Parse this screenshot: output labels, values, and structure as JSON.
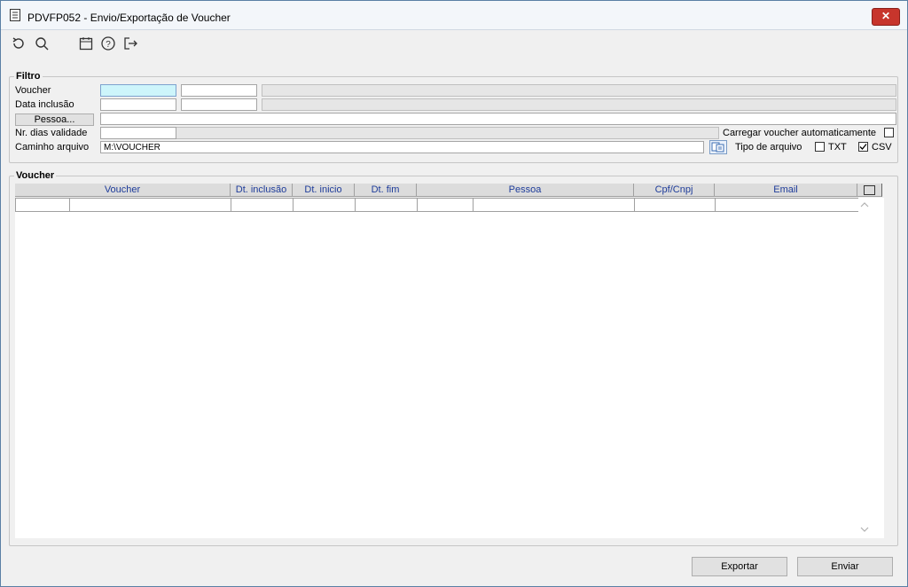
{
  "window": {
    "title": "PDVFP052 - Envio/Exportação de Voucher",
    "close_label": "✕"
  },
  "toolbar": {
    "icons": [
      "refresh-icon",
      "search-icon",
      "calendar-icon",
      "help-icon",
      "exit-icon"
    ]
  },
  "filtro": {
    "group_label": "Filtro",
    "voucher_label": "Voucher",
    "voucher_from": "",
    "voucher_to": "",
    "data_inclusao_label": "Data inclusão",
    "data_inclusao_from": "",
    "data_inclusao_to": "",
    "pessoa_button": "Pessoa...",
    "pessoa_value": "",
    "nr_dias_label": "Nr. dias validade",
    "nr_dias_value": "",
    "carregar_label": "Carregar voucher automaticamente",
    "carregar_checked": false,
    "caminho_label": "Caminho arquivo",
    "caminho_value": "M:\\VOUCHER",
    "tipo_label": "Tipo de arquivo",
    "txt_label": "TXT",
    "txt_checked": false,
    "csv_label": "CSV",
    "csv_checked": true
  },
  "voucher_grid": {
    "group_label": "Voucher",
    "columns": [
      "Voucher",
      "Dt. inclusão",
      "Dt. inicio",
      "Dt. fim",
      "Pessoa",
      "Cpf/Cnpj",
      "Email"
    ],
    "rows": [
      [
        "",
        "",
        "",
        "",
        "",
        "",
        "",
        "",
        ""
      ]
    ]
  },
  "footer": {
    "exportar_label": "Exportar",
    "enviar_label": "Enviar"
  }
}
